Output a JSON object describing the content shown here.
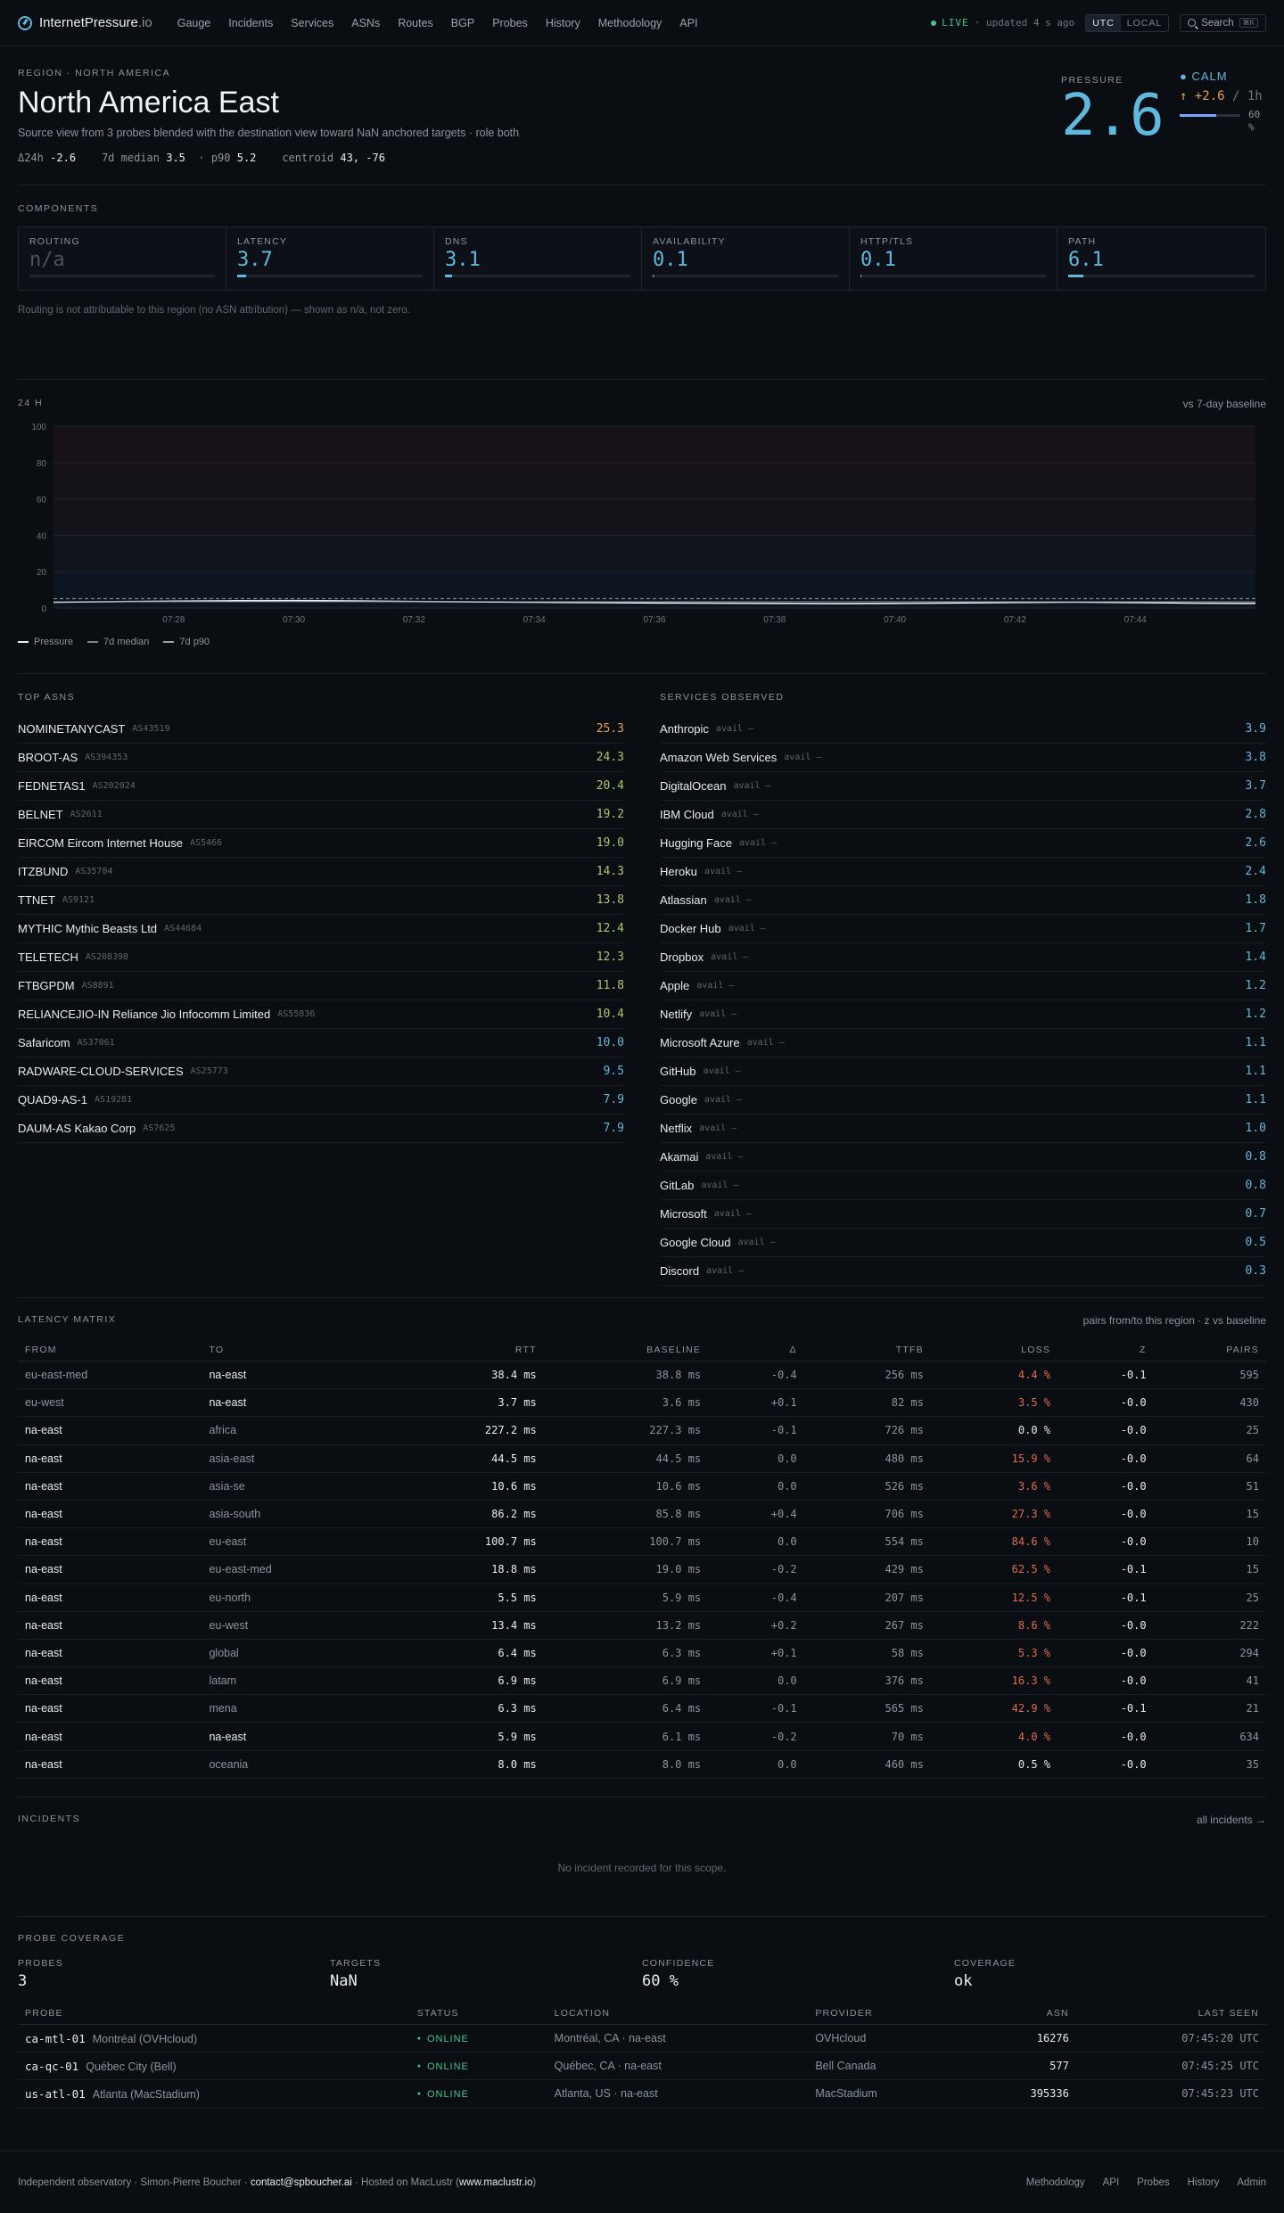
{
  "nav": {
    "brand_name": "InternetPressure",
    "brand_tld": ".io",
    "items": [
      "Gauge",
      "Incidents",
      "Services",
      "ASNs",
      "Routes",
      "BGP",
      "Probes",
      "History",
      "Methodology",
      "API"
    ],
    "live_label": "LIVE",
    "updated": "· updated 4 s ago",
    "tz_utc": "UTC",
    "tz_local": "LOCAL",
    "search_label": "Search",
    "search_kbd": "⌘K"
  },
  "header": {
    "region_label": "REGION · NORTH AMERICA",
    "title": "North America East",
    "subtitle": "Source view from 3 probes blended with the destination view toward NaN anchored targets · role both",
    "delta_label": "Δ24h",
    "delta_val": "-2.6",
    "median_label": "7d median",
    "median_val": "3.5",
    "p90_label": "p90",
    "p90_val": "5.2",
    "centroid_label": "centroid",
    "centroid_val": "43, -76"
  },
  "pressure": {
    "label": "PRESSURE",
    "value": "2.6",
    "state": "● CALM",
    "delta": "↑ +2.6",
    "delta_unit": "/ 1h",
    "confidence_pct": 60,
    "confidence_label": "60 %"
  },
  "components": {
    "label": "COMPONENTS",
    "items": [
      {
        "label": "ROUTING",
        "value": "n/a",
        "level": 0
      },
      {
        "label": "LATENCY",
        "value": "3.7",
        "level": 3.7
      },
      {
        "label": "DNS",
        "value": "3.1",
        "level": 3.1
      },
      {
        "label": "AVAILABILITY",
        "value": "0.1",
        "level": 0.1
      },
      {
        "label": "HTTP/TLS",
        "value": "0.1",
        "level": 0.1
      },
      {
        "label": "PATH",
        "value": "6.1",
        "level": 6.1
      }
    ],
    "note": "Routing is not attributable to this region (no ASN attribution) — shown as n/a, not zero."
  },
  "chart_data": {
    "type": "line",
    "title": "24 H",
    "compare_label": "vs 7-day baseline",
    "ylim": [
      0,
      100
    ],
    "yticks": [
      0,
      20,
      40,
      60,
      80,
      100
    ],
    "x_ticks": [
      "07:28",
      "07:30",
      "07:32",
      "07:34",
      "07:36",
      "07:38",
      "07:40",
      "07:42",
      "07:44"
    ],
    "x": [
      "07:26",
      "07:27",
      "07:28",
      "07:29",
      "07:30",
      "07:31",
      "07:32",
      "07:33",
      "07:34",
      "07:35",
      "07:36",
      "07:37",
      "07:38",
      "07:39",
      "07:40",
      "07:41",
      "07:42",
      "07:43",
      "07:44",
      "07:45",
      "07:46"
    ],
    "series": [
      {
        "name": "Pressure",
        "color": "#e6edf3",
        "values": [
          3.2,
          3.5,
          3.8,
          4.0,
          4.1,
          3.9,
          3.6,
          3.4,
          3.2,
          3.0,
          2.8,
          2.7,
          2.6,
          2.5,
          2.6,
          2.8,
          3.1,
          3.3,
          3.0,
          2.7,
          2.6
        ]
      },
      {
        "name": "7d median",
        "color": "#7d8590",
        "values": [
          3.5,
          3.5,
          3.5,
          3.5,
          3.5,
          3.5,
          3.5,
          3.5,
          3.5,
          3.5,
          3.5,
          3.5,
          3.5,
          3.5,
          3.5,
          3.5,
          3.5,
          3.5,
          3.5,
          3.5,
          3.5
        ]
      },
      {
        "name": "7d p90",
        "color": "#9aa3ad",
        "values": [
          5.2,
          5.2,
          5.2,
          5.2,
          5.2,
          5.2,
          5.2,
          5.2,
          5.2,
          5.2,
          5.2,
          5.2,
          5.2,
          5.2,
          5.2,
          5.2,
          5.2,
          5.2,
          5.2,
          5.2,
          5.2
        ]
      }
    ],
    "bands": [
      {
        "from": 0,
        "to": 20,
        "color": "#0d1520"
      },
      {
        "from": 20,
        "to": 40,
        "color": "#10141a"
      },
      {
        "from": 40,
        "to": 60,
        "color": "#14131a"
      },
      {
        "from": 60,
        "to": 80,
        "color": "#161219"
      },
      {
        "from": 80,
        "to": 100,
        "color": "#191118"
      }
    ],
    "grid": true,
    "legend": "bottom-left"
  },
  "asns": {
    "label": "TOP ASNS",
    "items": [
      {
        "name": "NOMINETANYCAST",
        "asn": "AS43519",
        "val": "25.3",
        "color": "#e3a25b"
      },
      {
        "name": "BROOT-AS",
        "asn": "AS394353",
        "val": "24.3",
        "color": "#a6c96a"
      },
      {
        "name": "FEDNETAS1",
        "asn": "AS202024",
        "val": "20.4",
        "color": "#a6c96a"
      },
      {
        "name": "BELNET",
        "asn": "AS2611",
        "val": "19.2",
        "color": "#a6c96a"
      },
      {
        "name": "EIRCOM Eircom Internet House",
        "asn": "AS5466",
        "val": "19.0",
        "color": "#a6c96a"
      },
      {
        "name": "ITZBUND",
        "asn": "AS35704",
        "val": "14.3",
        "color": "#a6c96a"
      },
      {
        "name": "TTNET",
        "asn": "AS9121",
        "val": "13.8",
        "color": "#a6c96a"
      },
      {
        "name": "MYTHIC Mythic Beasts Ltd",
        "asn": "AS44684",
        "val": "12.4",
        "color": "#a6c96a"
      },
      {
        "name": "TELETECH",
        "asn": "AS208398",
        "val": "12.3",
        "color": "#a6c96a"
      },
      {
        "name": "FTBGPDM",
        "asn": "AS8891",
        "val": "11.8",
        "color": "#a6c96a"
      },
      {
        "name": "RELIANCEJIO-IN Reliance Jio Infocomm Limited",
        "asn": "AS55836",
        "val": "10.4",
        "color": "#a6c96a"
      },
      {
        "name": "Safaricom",
        "asn": "AS37061",
        "val": "10.0",
        "color": "#5fb8dd"
      },
      {
        "name": "RADWARE-CLOUD-SERVICES",
        "asn": "AS25773",
        "val": "9.5",
        "color": "#5fb8dd"
      },
      {
        "name": "QUAD9-AS-1",
        "asn": "AS19281",
        "val": "7.9",
        "color": "#5fb8dd"
      },
      {
        "name": "DAUM-AS Kakao Corp",
        "asn": "AS7625",
        "val": "7.9",
        "color": "#5fb8dd"
      }
    ]
  },
  "services": {
    "label": "SERVICES OBSERVED",
    "avail": "avail –",
    "items": [
      {
        "name": "Anthropic",
        "val": "3.9"
      },
      {
        "name": "Amazon Web Services",
        "val": "3.8"
      },
      {
        "name": "DigitalOcean",
        "val": "3.7"
      },
      {
        "name": "IBM Cloud",
        "val": "2.8"
      },
      {
        "name": "Hugging Face",
        "val": "2.6"
      },
      {
        "name": "Heroku",
        "val": "2.4"
      },
      {
        "name": "Atlassian",
        "val": "1.8"
      },
      {
        "name": "Docker Hub",
        "val": "1.7"
      },
      {
        "name": "Dropbox",
        "val": "1.4"
      },
      {
        "name": "Apple",
        "val": "1.2"
      },
      {
        "name": "Netlify",
        "val": "1.2"
      },
      {
        "name": "Microsoft Azure",
        "val": "1.1"
      },
      {
        "name": "GitHub",
        "val": "1.1"
      },
      {
        "name": "Google",
        "val": "1.1"
      },
      {
        "name": "Netflix",
        "val": "1.0"
      },
      {
        "name": "Akamai",
        "val": "0.8"
      },
      {
        "name": "GitLab",
        "val": "0.8"
      },
      {
        "name": "Microsoft",
        "val": "0.7"
      },
      {
        "name": "Google Cloud",
        "val": "0.5"
      },
      {
        "name": "Discord",
        "val": "0.3"
      }
    ]
  },
  "matrix": {
    "label": "LATENCY MATRIX",
    "right": "pairs from/to this region · z vs baseline",
    "headers": [
      "FROM",
      "TO",
      "RTT",
      "BASELINE",
      "Δ",
      "TTFB",
      "LOSS",
      "Z",
      "PAIRS"
    ],
    "rows": [
      {
        "from": "eu-east-med",
        "to": "na-east",
        "rtt": "38.4 ms",
        "base": "38.8 ms",
        "d": "-0.4",
        "ttfb": "256 ms",
        "loss": "4.4 %",
        "hi": true,
        "z": "-0.1",
        "pairs": "595",
        "fh": false,
        "th": true
      },
      {
        "from": "eu-west",
        "to": "na-east",
        "rtt": "3.7 ms",
        "base": "3.6 ms",
        "d": "+0.1",
        "ttfb": "82 ms",
        "loss": "3.5 %",
        "hi": true,
        "z": "-0.0",
        "pairs": "430",
        "fh": false,
        "th": true
      },
      {
        "from": "na-east",
        "to": "africa",
        "rtt": "227.2 ms",
        "base": "227.3 ms",
        "d": "-0.1",
        "ttfb": "726 ms",
        "loss": "0.0 %",
        "hi": false,
        "z": "-0.0",
        "pairs": "25",
        "fh": true,
        "th": false
      },
      {
        "from": "na-east",
        "to": "asia-east",
        "rtt": "44.5 ms",
        "base": "44.5 ms",
        "d": "0.0",
        "ttfb": "480 ms",
        "loss": "15.9 %",
        "hi": true,
        "z": "-0.0",
        "pairs": "64",
        "fh": true,
        "th": false
      },
      {
        "from": "na-east",
        "to": "asia-se",
        "rtt": "10.6 ms",
        "base": "10.6 ms",
        "d": "0.0",
        "ttfb": "526 ms",
        "loss": "3.6 %",
        "hi": true,
        "z": "-0.0",
        "pairs": "51",
        "fh": true,
        "th": false
      },
      {
        "from": "na-east",
        "to": "asia-south",
        "rtt": "86.2 ms",
        "base": "85.8 ms",
        "d": "+0.4",
        "ttfb": "706 ms",
        "loss": "27.3 %",
        "hi": true,
        "z": "-0.0",
        "pairs": "15",
        "fh": true,
        "th": false
      },
      {
        "from": "na-east",
        "to": "eu-east",
        "rtt": "100.7 ms",
        "base": "100.7 ms",
        "d": "0.0",
        "ttfb": "554 ms",
        "loss": "84.6 %",
        "hi": true,
        "z": "-0.0",
        "pairs": "10",
        "fh": true,
        "th": false
      },
      {
        "from": "na-east",
        "to": "eu-east-med",
        "rtt": "18.8 ms",
        "base": "19.0 ms",
        "d": "-0.2",
        "ttfb": "429 ms",
        "loss": "62.5 %",
        "hi": true,
        "z": "-0.1",
        "pairs": "15",
        "fh": true,
        "th": false
      },
      {
        "from": "na-east",
        "to": "eu-north",
        "rtt": "5.5 ms",
        "base": "5.9 ms",
        "d": "-0.4",
        "ttfb": "207 ms",
        "loss": "12.5 %",
        "hi": true,
        "z": "-0.1",
        "pairs": "25",
        "fh": true,
        "th": false
      },
      {
        "from": "na-east",
        "to": "eu-west",
        "rtt": "13.4 ms",
        "base": "13.2 ms",
        "d": "+0.2",
        "ttfb": "267 ms",
        "loss": "8.6 %",
        "hi": true,
        "z": "-0.0",
        "pairs": "222",
        "fh": true,
        "th": false
      },
      {
        "from": "na-east",
        "to": "global",
        "rtt": "6.4 ms",
        "base": "6.3 ms",
        "d": "+0.1",
        "ttfb": "58 ms",
        "loss": "5.3 %",
        "hi": true,
        "z": "-0.0",
        "pairs": "294",
        "fh": true,
        "th": false
      },
      {
        "from": "na-east",
        "to": "latam",
        "rtt": "6.9 ms",
        "base": "6.9 ms",
        "d": "0.0",
        "ttfb": "376 ms",
        "loss": "16.3 %",
        "hi": true,
        "z": "-0.0",
        "pairs": "41",
        "fh": true,
        "th": false
      },
      {
        "from": "na-east",
        "to": "mena",
        "rtt": "6.3 ms",
        "base": "6.4 ms",
        "d": "-0.1",
        "ttfb": "565 ms",
        "loss": "42.9 %",
        "hi": true,
        "z": "-0.1",
        "pairs": "21",
        "fh": true,
        "th": false
      },
      {
        "from": "na-east",
        "to": "na-east",
        "rtt": "5.9 ms",
        "base": "6.1 ms",
        "d": "-0.2",
        "ttfb": "70 ms",
        "loss": "4.0 %",
        "hi": true,
        "z": "-0.0",
        "pairs": "634",
        "fh": true,
        "th": true
      },
      {
        "from": "na-east",
        "to": "oceania",
        "rtt": "8.0 ms",
        "base": "8.0 ms",
        "d": "0.0",
        "ttfb": "460 ms",
        "loss": "0.5 %",
        "hi": false,
        "z": "-0.0",
        "pairs": "35",
        "fh": true,
        "th": false
      }
    ]
  },
  "incidents": {
    "label": "INCIDENTS",
    "link": "all incidents →",
    "empty": "No incident recorded for this scope."
  },
  "probes": {
    "label": "PROBE COVERAGE",
    "stats": [
      {
        "label": "PROBES",
        "value": "3"
      },
      {
        "label": "TARGETS",
        "value": "NaN"
      },
      {
        "label": "CONFIDENCE",
        "value": "60 %"
      },
      {
        "label": "COVERAGE",
        "value": "ok"
      }
    ],
    "headers": [
      "PROBE",
      "STATUS",
      "LOCATION",
      "PROVIDER",
      "ASN",
      "LAST SEEN"
    ],
    "rows": [
      {
        "id": "ca-mtl-01",
        "name": "Montréal (OVHcloud)",
        "status": "ONLINE",
        "loc": "Montréal, CA · na-east",
        "prov": "OVHcloud",
        "asn": "16276",
        "seen": "07:45:20",
        "tz": "UTC"
      },
      {
        "id": "ca-qc-01",
        "name": "Québec City (Bell)",
        "status": "ONLINE",
        "loc": "Québec, CA · na-east",
        "prov": "Bell Canada",
        "asn": "577",
        "seen": "07:45:25",
        "tz": "UTC"
      },
      {
        "id": "us-atl-01",
        "name": "Atlanta (MacStadium)",
        "status": "ONLINE",
        "loc": "Atlanta, US · na-east",
        "prov": "MacStadium",
        "asn": "395336",
        "seen": "07:45:23",
        "tz": "UTC"
      }
    ]
  },
  "footer": {
    "text1": "Independent observatory · Simon-Pierre Boucher ·",
    "email": "contact@spboucher.ai",
    "text2": "· Hosted on MacLustr (",
    "host": "www.maclustr.io",
    "text3": ")",
    "links": [
      "Methodology",
      "API",
      "Probes",
      "History",
      "Admin"
    ]
  }
}
